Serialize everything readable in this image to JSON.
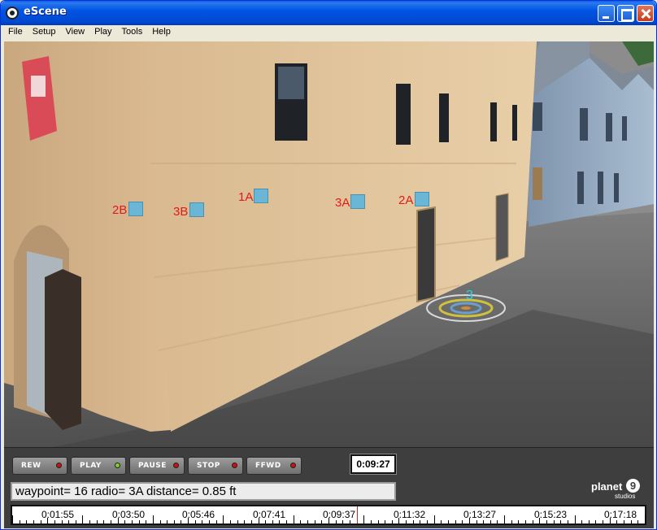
{
  "window": {
    "title": "eScene"
  },
  "menu": [
    "File",
    "Setup",
    "View",
    "Play",
    "Tools",
    "Help"
  ],
  "markers": [
    {
      "label": "2B"
    },
    {
      "label": "3B"
    },
    {
      "label": "1A"
    },
    {
      "label": "3A"
    },
    {
      "label": "2A"
    }
  ],
  "current_waypoint": {
    "label": "3"
  },
  "controls": {
    "buttons": [
      {
        "label": "REW",
        "led": "#cc1111"
      },
      {
        "label": "PLAY",
        "led": "#7ed321"
      },
      {
        "label": "PAUSE",
        "led": "#cc1111"
      },
      {
        "label": "STOP",
        "led": "#cc1111"
      },
      {
        "label": "FFWD",
        "led": "#cc1111"
      }
    ],
    "timecode": "0:09:27"
  },
  "status": {
    "text": "waypoint= 16  radio= 3A  distance= 0.85 ft"
  },
  "logo": {
    "word": "planet",
    "badge": "9",
    "sub": "studios"
  },
  "timeline": {
    "labels": [
      "0:01:55",
      "0:03:50",
      "0:05:46",
      "0:07:41",
      "0:09:37",
      "0:11:32",
      "0:13:27",
      "0:15:23",
      "0:17:18"
    ],
    "playhead_fraction": 0.545
  },
  "colors": {
    "marker_text": "#e01b1b",
    "marker_box": "#6ab6d6",
    "waypoint_text": "#26d4e6"
  }
}
